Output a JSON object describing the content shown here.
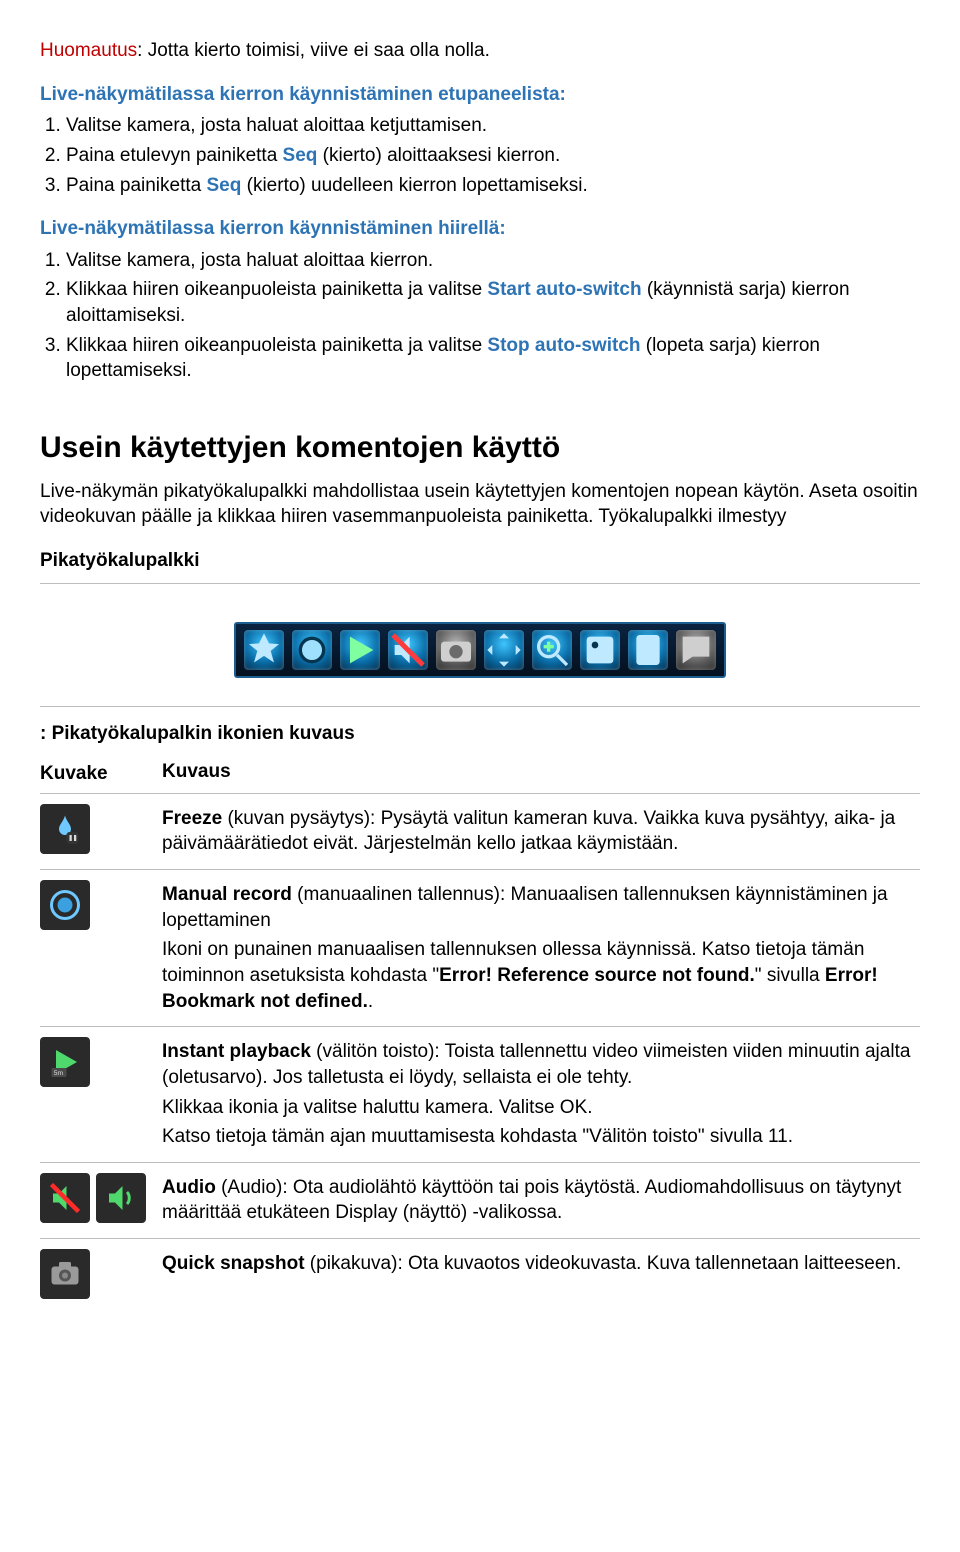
{
  "note": {
    "label": "Huomautus",
    "text": ": Jotta kierto toimisi, viive ei saa olla nolla."
  },
  "heading1": "Live-näkymätilassa kierron käynnistäminen etupaneelista:",
  "list1": {
    "i1": "Valitse kamera, josta haluat aloittaa ketjuttamisen.",
    "i2a": "Paina etulevyn painiketta ",
    "i2b": "Seq",
    "i2c": " (kierto) aloittaaksesi kierron.",
    "i3a": "Paina painiketta ",
    "i3b": "Seq",
    "i3c": " (kierto) uudelleen kierron lopettamiseksi."
  },
  "heading2": "Live-näkymätilassa kierron käynnistäminen hiirellä:",
  "list2": {
    "i1": "Valitse kamera, josta haluat aloittaa kierron.",
    "i2a": "Klikkaa hiiren oikeanpuoleista painiketta ja valitse ",
    "i2b": "Start auto-switch",
    "i2c": " (käynnistä sarja) kierron aloittamiseksi.",
    "i3a": "Klikkaa hiiren oikeanpuoleista painiketta ja valitse ",
    "i3b": "Stop auto-switch",
    "i3c": " (lopeta sarja) kierron lopettamiseksi."
  },
  "section_title": "Usein käytettyjen komentojen käyttö",
  "section_text": "Live-näkymän pikatyökalupalkki mahdollistaa usein käytettyjen komentojen nopean käytön. Aseta osoitin videokuvan päälle ja klikkaa hiiren vasemmanpuoleista painiketta. Työkalupalkki ilmestyy",
  "toolbar_label": "Pikatyökalupalkki",
  "table_title": ": Pikatyökalupalkin ikonien kuvaus",
  "th_icon": "Kuvake",
  "th_desc": "Kuvaus",
  "rows": {
    "freeze": {
      "title": "Freeze",
      "text": " (kuvan pysäytys): Pysäytä valitun kameran kuva. Vaikka kuva pysähtyy, aika- ja päivämäärätiedot eivät. Järjestelmän kello jatkaa käymistään."
    },
    "record": {
      "title": "Manual record",
      "p1": " (manuaalinen tallennus): Manuaalisen tallennuksen käynnistäminen ja lopettaminen",
      "p2a": "Ikoni on punainen manuaalisen tallennuksen ollessa käynnissä. Katso tietoja tämän toiminnon asetuksista kohdasta \"",
      "p2b": "Error! Reference source not found.",
      "p2c": "\" sivulla ",
      "p2d": "Error! Bookmark not defined.",
      "p2e": "."
    },
    "playback": {
      "title": "Instant playback",
      "p1": " (välitön toisto): Toista tallennettu video viimeisten viiden minuutin ajalta (oletusarvo). Jos talletusta ei löydy, sellaista ei ole tehty.",
      "p2": "Klikkaa ikonia ja valitse haluttu kamera. Valitse OK.",
      "p3": "Katso tietoja tämän ajan muuttamisesta kohdasta \"Välitön toisto\" sivulla 11."
    },
    "audio": {
      "title": "Audio",
      "text": " (Audio): Ota audiolähtö käyttöön tai pois käytöstä. Audiomahdollisuus on täytynyt määrittää etukäteen Display (näyttö) -valikossa."
    },
    "snapshot": {
      "title": "Quick snapshot",
      "text": " (pikakuva): Ota kuvaotos videokuvasta. Kuva tallennetaan laitteeseen."
    }
  }
}
